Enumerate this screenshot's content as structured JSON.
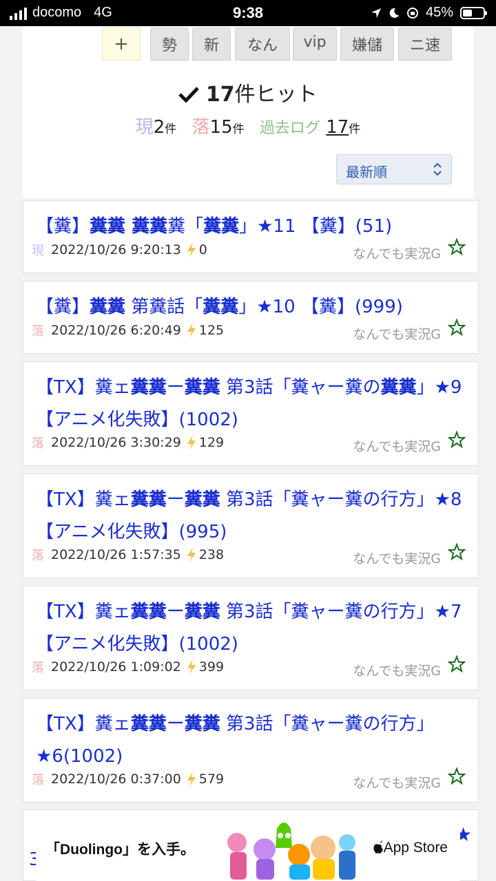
{
  "status_bar": {
    "carrier": "docomo",
    "network": "4G",
    "time": "9:38",
    "battery": "45%",
    "battery_level": 0.45
  },
  "tabs": [
    "+",
    "勢",
    "新",
    "なん",
    "vip",
    "嫌儲",
    "ニ速"
  ],
  "search": {
    "hit_count": "17",
    "hit_suffix": "件ヒット",
    "current_label": "現",
    "current_count": "2",
    "fallen_label": "落",
    "fallen_count": "15",
    "unit": "件",
    "log_label": "過去ログ",
    "log_count": "17"
  },
  "sort": {
    "selected": "最新順"
  },
  "threads": [
    {
      "title_html": "【糞】<b>糞糞 糞糞</b>糞「<b>糞糞</b>」★11 【糞】(51)",
      "status": "現",
      "datetime": "2022/10/26 9:20:13",
      "count": "0",
      "board": "なんでも実況G"
    },
    {
      "title_html": "【糞】<b>糞糞</b> 第糞話「<b>糞糞</b>」★10 【糞】(999)",
      "status": "落",
      "datetime": "2022/10/26 6:20:49",
      "count": "125",
      "board": "なんでも実況G"
    },
    {
      "title_html": "【TX】糞ェ<b>糞糞</b>ー<b>糞糞</b> 第3話「糞ャー糞の<b>糞糞</b>」★9 【アニメ化失敗】(1002)",
      "status": "落",
      "datetime": "2022/10/26 3:30:29",
      "count": "129",
      "board": "なんでも実況G"
    },
    {
      "title_html": "【TX】糞ェ<b>糞糞</b>ー<b>糞糞</b> 第3話「糞ャー糞の行方」★8 【アニメ化失敗】(995)",
      "status": "落",
      "datetime": "2022/10/26 1:57:35",
      "count": "238",
      "board": "なんでも実況G"
    },
    {
      "title_html": "【TX】糞ェ<b>糞糞</b>ー<b>糞糞</b> 第3話「糞ャー糞の行方」★7 【アニメ化失敗】(1002)",
      "status": "落",
      "datetime": "2022/10/26 1:09:02",
      "count": "399",
      "board": "なんでも実況G"
    },
    {
      "title_html": "【TX】糞ェ<b>糞糞</b>ー<b>糞糞</b> 第3話「糞ャー糞の行方」★6(1002)",
      "status": "落",
      "datetime": "2022/10/26 0:37:00",
      "count": "579",
      "board": "なんでも実況G"
    }
  ],
  "ad": {
    "text": "「Duolingo」を入手。",
    "store": "App Store"
  },
  "colors": {
    "link": "#1a2fcf",
    "current": "#c0c0ea",
    "fallen": "#f0b0b0",
    "star": "#1e6b1e",
    "bolt": "#f6c14a"
  }
}
